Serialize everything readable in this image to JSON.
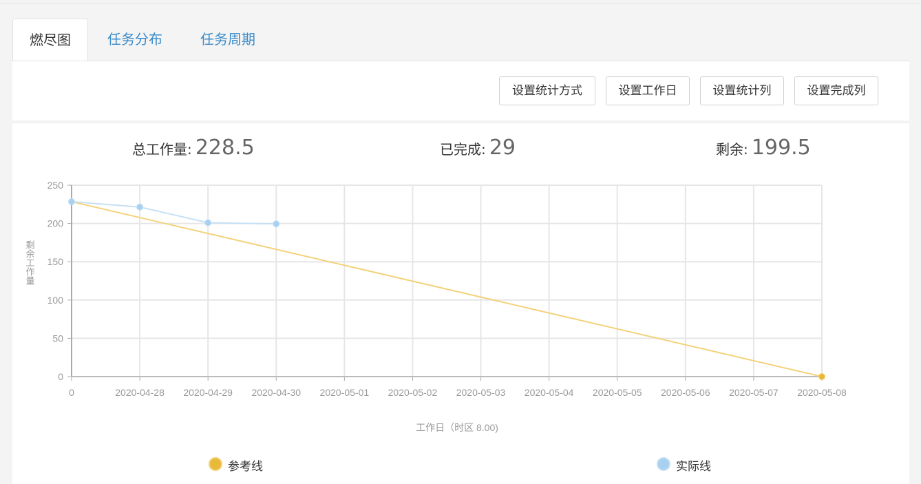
{
  "tabs": [
    {
      "label": "燃尽图",
      "active": true
    },
    {
      "label": "任务分布",
      "active": false
    },
    {
      "label": "任务周期",
      "active": false
    }
  ],
  "toolbar": {
    "buttons": [
      "设置统计方式",
      "设置工作日",
      "设置统计列",
      "设置完成列"
    ]
  },
  "stats": {
    "total_label": "总工作量:",
    "total_value": "228.5",
    "done_label": "已完成:",
    "done_value": "29",
    "remaining_label": "剩余:",
    "remaining_value": "199.5"
  },
  "chart_data": {
    "type": "line",
    "xlabel": "工作日（时区 8.00)",
    "ylabel": "剩余工作量",
    "categories": [
      "0",
      "2020-04-28",
      "2020-04-29",
      "2020-04-30",
      "2020-05-01",
      "2020-05-02",
      "2020-05-03",
      "2020-05-04",
      "2020-05-05",
      "2020-05-06",
      "2020-05-07",
      "2020-05-08"
    ],
    "ylim": [
      0,
      250
    ],
    "yticks": [
      0,
      50,
      100,
      150,
      200,
      250
    ],
    "grid": true,
    "legend_position": "bottom",
    "series": [
      {
        "name": "参考线",
        "color": "#f3d27a",
        "marker_color": "#e9b93a",
        "values": [
          228.5,
          null,
          null,
          null,
          null,
          null,
          null,
          null,
          null,
          null,
          null,
          0
        ]
      },
      {
        "name": "实际线",
        "color": "#c5e0f5",
        "marker_color": "#a8d0f0",
        "values": [
          228.5,
          221.5,
          201,
          199.5,
          null,
          null,
          null,
          null,
          null,
          null,
          null,
          null
        ]
      }
    ]
  }
}
